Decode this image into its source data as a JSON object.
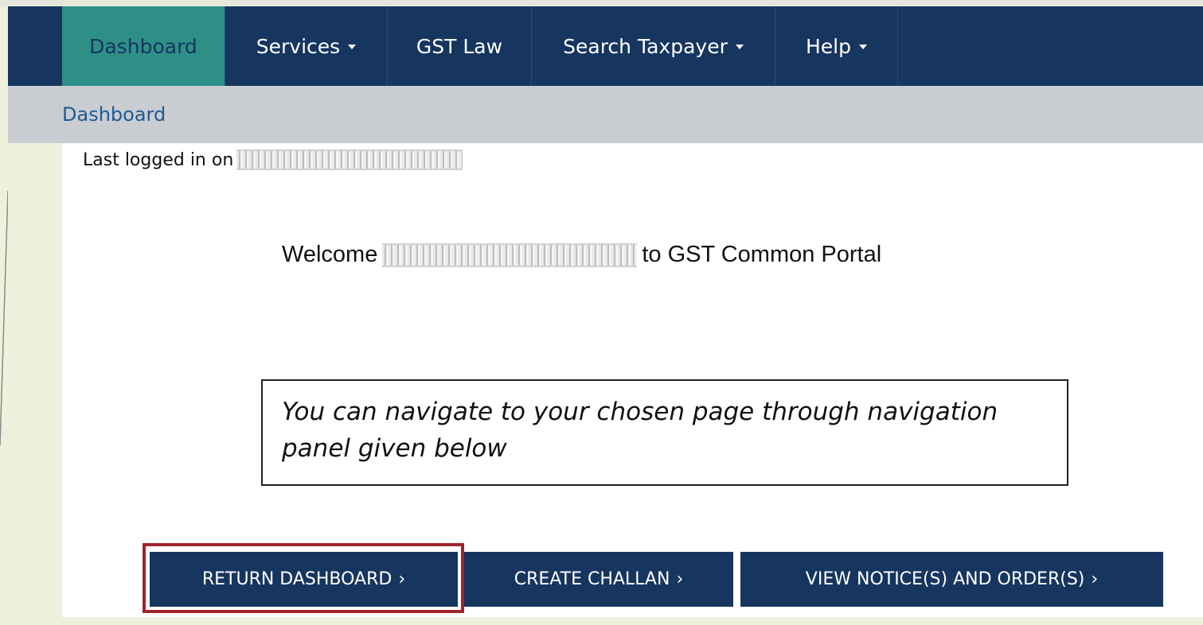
{
  "nav": {
    "items": [
      {
        "label": "Dashboard",
        "has_caret": false,
        "active": true
      },
      {
        "label": "Services",
        "has_caret": true,
        "active": false
      },
      {
        "label": "GST Law",
        "has_caret": false,
        "active": false
      },
      {
        "label": "Search Taxpayer",
        "has_caret": true,
        "active": false
      },
      {
        "label": "Help",
        "has_caret": true,
        "active": false
      }
    ]
  },
  "breadcrumb": {
    "label": "Dashboard"
  },
  "main": {
    "last_login_label": "Last logged in on",
    "welcome_prefix": "Welcome",
    "welcome_suffix": "to GST Common Portal",
    "navigation_note": "You can navigate to your chosen page through navigation panel given below",
    "actions": [
      {
        "label": "RETURN DASHBOARD",
        "chevron": "›",
        "highlighted": true
      },
      {
        "label": "CREATE CHALLAN",
        "chevron": "›",
        "highlighted": false
      },
      {
        "label": "VIEW NOTICE(S) AND ORDER(S)",
        "chevron": "›",
        "highlighted": false
      }
    ]
  },
  "colors": {
    "navbar_bg": "#16355f",
    "active_tab_bg": "#2e8f87",
    "breadcrumb_bar_bg": "#c9ccd1",
    "breadcrumb_text": "#1f5a96",
    "button_bg": "#16355f",
    "highlight_border": "#a3222b"
  },
  "icons": {
    "dropdown": "caret-down-icon",
    "button_chevron": "chevron-right-icon"
  }
}
